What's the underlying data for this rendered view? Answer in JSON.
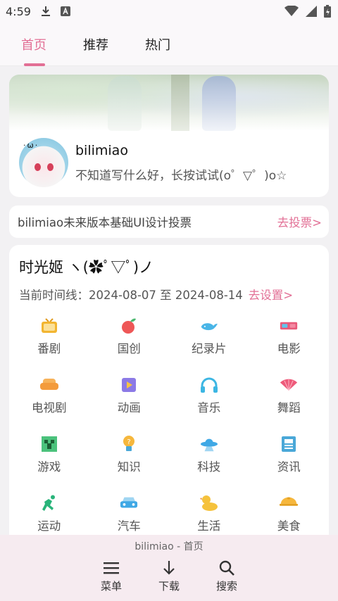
{
  "status_bar": {
    "time": "4:59"
  },
  "tabs": [
    {
      "label": "首页",
      "active": true
    },
    {
      "label": "推荐",
      "active": false
    },
    {
      "label": "热门",
      "active": false
    }
  ],
  "profile": {
    "username": "bilimiao",
    "bio": "不知道写什么好，长按试试(o゜▽゜)o☆"
  },
  "vote": {
    "text": "bilimiao未来版本基础UI设计投票",
    "link": "去投票>"
  },
  "time_machine": {
    "title": "时光姬 ヽ(✿ﾟ▽ﾟ)ノ",
    "range_label": "当前时间线：2024-08-07 至 2024-08-14",
    "set_link": "去设置>"
  },
  "categories": [
    {
      "label": "番剧",
      "icon": "tv-icon",
      "color": "#f2b531"
    },
    {
      "label": "国创",
      "icon": "peach-icon",
      "color": "#ee5757"
    },
    {
      "label": "纪录片",
      "icon": "whale-icon",
      "color": "#49b5e7"
    },
    {
      "label": "电影",
      "icon": "3d-glasses-icon",
      "color": "#e85b7a"
    },
    {
      "label": "电视剧",
      "icon": "sofa-icon",
      "color": "#f39b3c"
    },
    {
      "label": "动画",
      "icon": "play-icon",
      "color": "#8c7ae6"
    },
    {
      "label": "音乐",
      "icon": "headphones-icon",
      "color": "#3cb6e3"
    },
    {
      "label": "舞蹈",
      "icon": "fan-icon",
      "color": "#ee5a7a"
    },
    {
      "label": "游戏",
      "icon": "creeper-icon",
      "color": "#4bc27c"
    },
    {
      "label": "知识",
      "icon": "lightbulb-icon",
      "color": "#f6b73c"
    },
    {
      "label": "科技",
      "icon": "ufo-icon",
      "color": "#3fa8e5"
    },
    {
      "label": "资讯",
      "icon": "newspaper-icon",
      "color": "#4aa8d8"
    },
    {
      "label": "运动",
      "icon": "runner-icon",
      "color": "#29b47a"
    },
    {
      "label": "汽车",
      "icon": "car-icon",
      "color": "#3fa8e5"
    },
    {
      "label": "生活",
      "icon": "duck-icon",
      "color": "#f5c23c"
    },
    {
      "label": "美食",
      "icon": "dish-icon",
      "color": "#f6b73c"
    }
  ],
  "bottom_bar": {
    "title": "bilimiao - 首页",
    "actions": [
      {
        "label": "菜单",
        "icon": "menu-icon"
      },
      {
        "label": "下载",
        "icon": "download-icon"
      },
      {
        "label": "搜索",
        "icon": "search-icon"
      }
    ]
  },
  "colors": {
    "accent": "#e26f95"
  }
}
